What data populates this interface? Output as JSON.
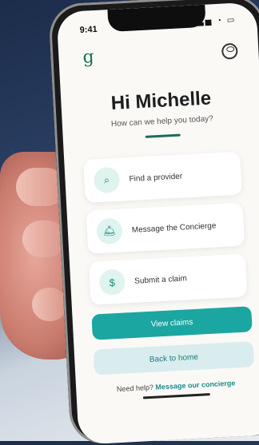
{
  "status": {
    "time": "9:41",
    "icons": "▂▃▅ ◔ ▭"
  },
  "logo": "g",
  "header": {
    "title": "Hi Michelle",
    "subtitle": "How can we help you today?"
  },
  "options": [
    {
      "label": "Find a provider",
      "icon": "search-icon",
      "glyph": "⌕"
    },
    {
      "label": "Message the Concierge",
      "icon": "concierge-bell-icon",
      "glyph": "🛎"
    },
    {
      "label": "Submit a claim",
      "icon": "dollar-receipt-icon",
      "glyph": "$"
    }
  ],
  "buttons": {
    "view_claims": "View claims",
    "back_home": "Back to home"
  },
  "help": {
    "prefix": "Need help?",
    "link": "Message our concierge"
  },
  "colors": {
    "brand": "#1b6e58",
    "primary": "#1ba6a1",
    "secondary": "#d9ecee"
  }
}
